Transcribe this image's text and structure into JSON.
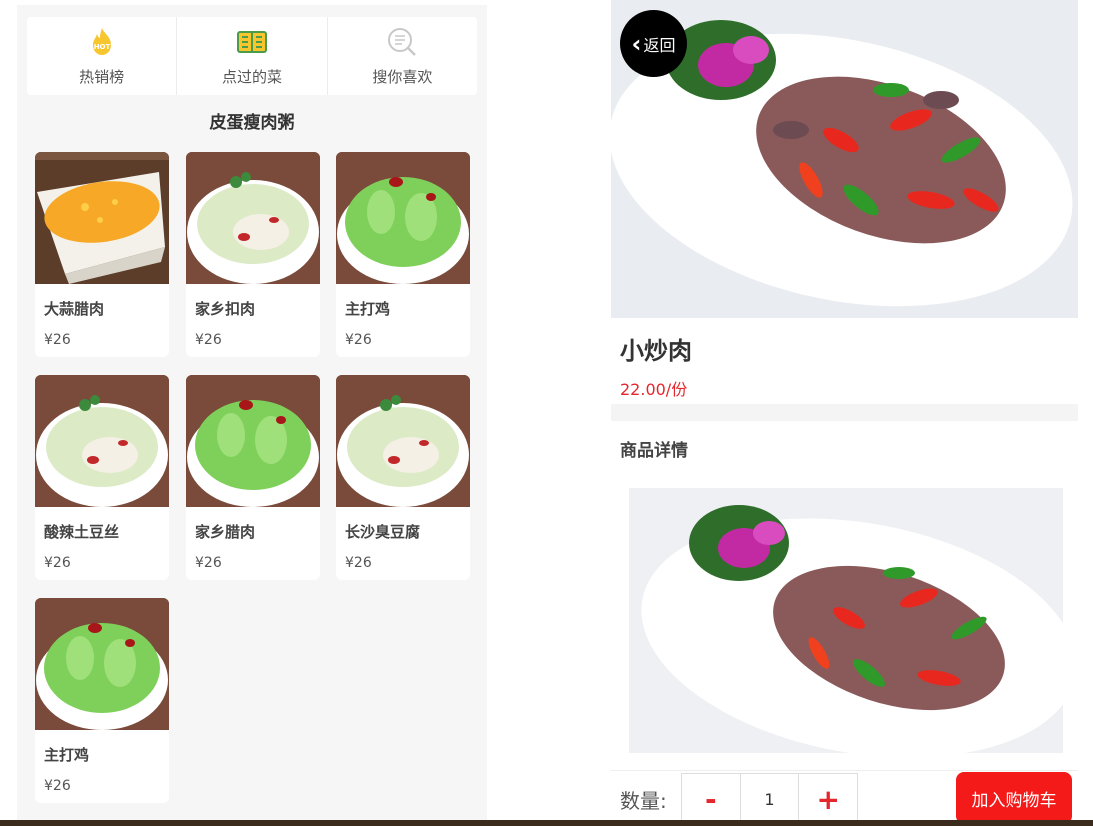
{
  "menu": {
    "tabs": [
      {
        "label": "热销榜",
        "icon": "hot-flame-icon"
      },
      {
        "label": "点过的菜",
        "icon": "book-icon"
      },
      {
        "label": "搜你喜欢",
        "icon": "search-list-icon"
      }
    ],
    "section_title": "皮蛋瘦肉粥",
    "dishes": [
      {
        "name": "大蒜腊肉",
        "price": "¥26",
        "image": "egg-custard"
      },
      {
        "name": "家乡扣肉",
        "price": "¥26",
        "image": "cabbage-white"
      },
      {
        "name": "主打鸡",
        "price": "¥26",
        "image": "cabbage-green"
      },
      {
        "name": "酸辣土豆丝",
        "price": "¥26",
        "image": "cabbage-white"
      },
      {
        "name": "家乡腊肉",
        "price": "¥26",
        "image": "cabbage-green"
      },
      {
        "name": "长沙臭豆腐",
        "price": "¥26",
        "image": "cabbage-white"
      },
      {
        "name": "主打鸡",
        "price": "¥26",
        "image": "cabbage-green"
      }
    ]
  },
  "product": {
    "back_label": "返回",
    "name": "小炒肉",
    "price": "22.00/份",
    "details_title": "商品详情",
    "quantity_label": "数量:",
    "minus_label": "-",
    "quantity": "1",
    "plus_label": "+",
    "add_to_cart_label": "加入购物车"
  },
  "colors": {
    "accent": "#e5262c",
    "cart_button": "#f51a1a",
    "panel_bg": "#f6f6f6"
  }
}
